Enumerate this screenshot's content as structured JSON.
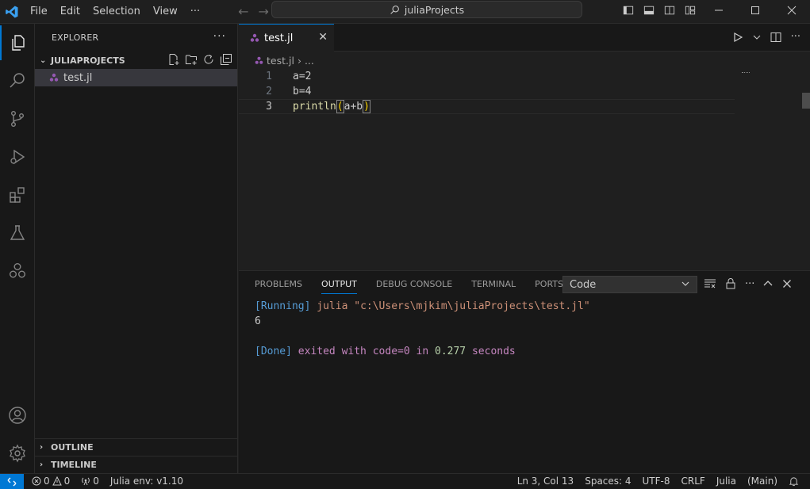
{
  "titlebar": {
    "menu": [
      "File",
      "Edit",
      "Selection",
      "View"
    ],
    "more": "···",
    "search": "juliaProjects"
  },
  "sidebar": {
    "title": "EXPLORER",
    "more": "···",
    "folder": "JULIAPROJECTS",
    "files": [
      {
        "name": "test.jl",
        "icon": "julia-file-icon"
      }
    ],
    "outline": "OUTLINE",
    "timeline": "TIMELINE"
  },
  "editor": {
    "tab": {
      "label": "test.jl",
      "close": "✕"
    },
    "breadcrumb": {
      "file": "test.jl",
      "sep": "›",
      "rest": "..."
    },
    "lines": [
      {
        "num": "1",
        "text": "a=2"
      },
      {
        "num": "2",
        "text": "b=4"
      },
      {
        "num": "3",
        "fn": "println",
        "open": "(",
        "arg": "a+b",
        "close": ")"
      }
    ]
  },
  "panel": {
    "tabs": [
      "PROBLEMS",
      "OUTPUT",
      "DEBUG CONSOLE",
      "TERMINAL",
      "PORTS"
    ],
    "active_tab": "OUTPUT",
    "channel": "Code",
    "output": {
      "running_tag": "[Running]",
      "running_cmd": " julia \"c:\\Users\\mjkim\\juliaProjects\\test.jl\"",
      "result": "6",
      "done_tag": "[Done]",
      "done_w1": " exited with ",
      "done_code": "code=0",
      "done_w2": " in ",
      "done_time": "0.277",
      "done_w3": " seconds"
    }
  },
  "statusbar": {
    "errors": "0",
    "warnings": "0",
    "ports": "0",
    "env": "Julia env: v1.10",
    "position": "Ln 3, Col 13",
    "spaces": "Spaces: 4",
    "encoding": "UTF-8",
    "eol": "CRLF",
    "language": "Julia",
    "main": "(Main)"
  },
  "colors": {
    "accent": "#0078d4",
    "julia": "#9558b2"
  }
}
